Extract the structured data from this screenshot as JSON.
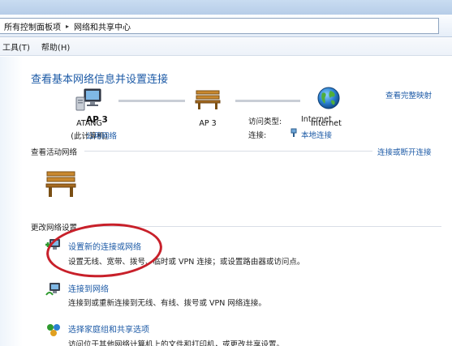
{
  "address": {
    "crumbs": [
      "所有控制面板项",
      "网络和共享中心"
    ]
  },
  "menu": {
    "items": [
      "工具(T)",
      "帮助(H)"
    ]
  },
  "header": {
    "title": "查看基本网络信息并设置连接",
    "full_map_link": "查看完整映射"
  },
  "map": {
    "computer": {
      "name": "ATANG",
      "sub": "(此计算机)"
    },
    "network": {
      "name": "AP  3"
    },
    "internet": {
      "name": "Internet"
    }
  },
  "active": {
    "section_label": "查看活动网络",
    "connect_link": "连接或断开连接",
    "network_name": "AP  3",
    "network_type": "公用网络",
    "access_type_label": "访问类型:",
    "access_type_value": "Internet",
    "connections_label": "连接:",
    "connections_value": "本地连接"
  },
  "change": {
    "section_label": "更改网络设置",
    "tasks": [
      {
        "title": "设置新的连接或网络",
        "desc": "设置无线、宽带、拨号、临时或 VPN 连接；或设置路由器或访问点。"
      },
      {
        "title": "连接到网络",
        "desc": "连接到或重新连接到无线、有线、拨号或 VPN 网络连接。"
      },
      {
        "title": "选择家庭组和共享选项",
        "desc": "访问位于其他网络计算机上的文件和打印机，或更改共享设置。"
      }
    ]
  },
  "colors": {
    "link": "#1c5aa6",
    "annotation": "#c8202a"
  }
}
